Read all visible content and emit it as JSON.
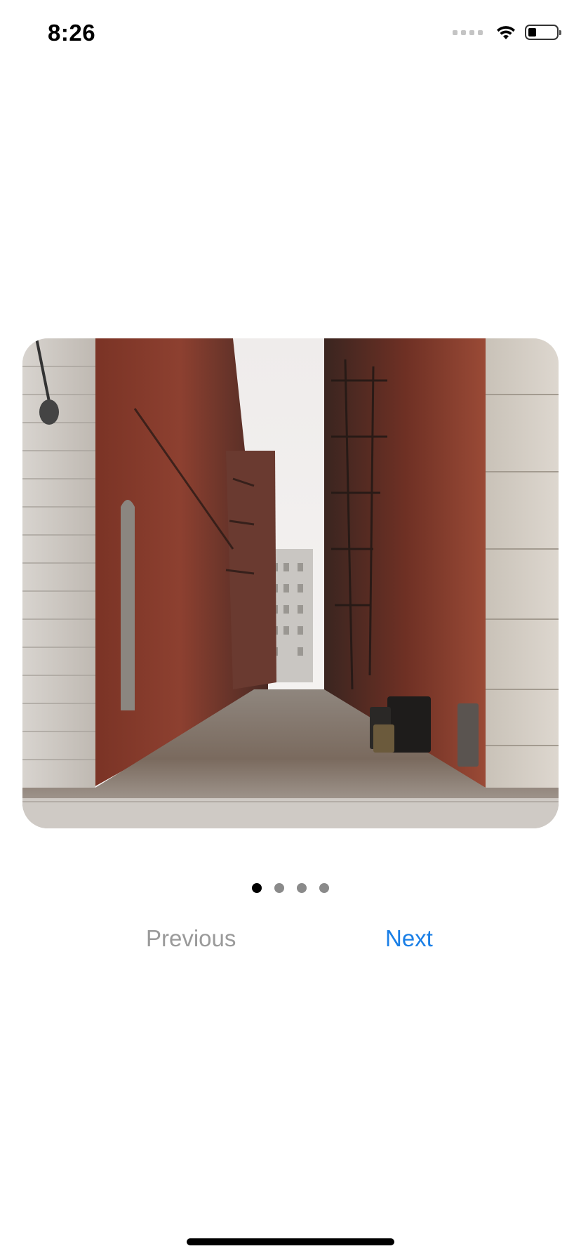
{
  "status_bar": {
    "time": "8:26",
    "icons": [
      "signal-dots",
      "wifi-icon",
      "battery-icon"
    ]
  },
  "carousel": {
    "image_description_icon": "photo",
    "page_count": 4,
    "current_page": 1
  },
  "navigation": {
    "previous_label": "Previous",
    "next_label": "Next"
  },
  "colors": {
    "accent": "#1a7fe6",
    "disabled": "#9a9a9a",
    "dot_active": "#000000",
    "dot_inactive": "#8a8a8a"
  }
}
